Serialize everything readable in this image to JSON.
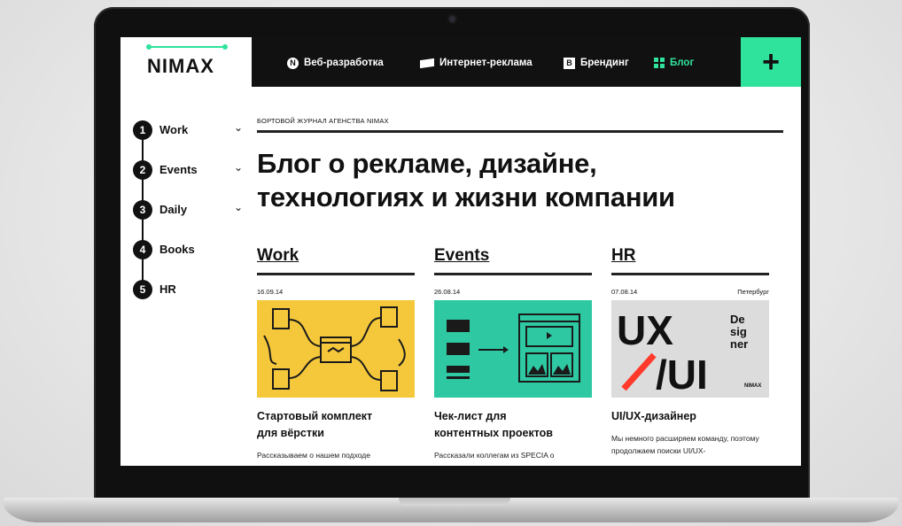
{
  "header": {
    "logo": "NIMAX",
    "nav": [
      {
        "icon": "n-circle-icon",
        "label": "Веб-разработка"
      },
      {
        "icon": "flag-icon",
        "label": "Интернет-реклама"
      },
      {
        "icon": "b-square-icon",
        "label": "Брендинг"
      },
      {
        "icon": "grid-icon",
        "label": "Блог"
      }
    ],
    "plus": "+"
  },
  "sidebar": {
    "items": [
      {
        "num": "1",
        "label": "Work",
        "chevron": "⌄"
      },
      {
        "num": "2",
        "label": "Events",
        "chevron": "⌄"
      },
      {
        "num": "3",
        "label": "Daily",
        "chevron": "⌄"
      },
      {
        "num": "4",
        "label": "Books",
        "chevron": ""
      },
      {
        "num": "5",
        "label": "HR",
        "chevron": ""
      }
    ]
  },
  "main": {
    "kicker": "БОРТОВОЙ ЖУРНАЛ АГЕНСТВА NIMAX",
    "title_line1": "Блог о рекламе, дизайне,",
    "title_line2": "технологиях и жизни компании",
    "columns": [
      {
        "heading": "Work",
        "date": "16.09.14",
        "location": "",
        "card_title_1": "Стартовый комплект",
        "card_title_2": "для вёрстки",
        "text": "Рассказываем о нашем подходе",
        "color": "#f5c83c"
      },
      {
        "heading": "Events",
        "date": "26.08.14",
        "location": "",
        "card_title_1": "Чек-лист для",
        "card_title_2": "контентных проектов",
        "text": "Рассказали коллегам из SPECIA о",
        "color": "#2ec9a3"
      },
      {
        "heading": "HR",
        "date": "07.08.14",
        "location": "Петербург",
        "card_title_1": "UI/UX-дизайнер",
        "card_title_2": "",
        "text": "Мы немного расширяем команду, поэтому продолжаем поиски UI/UX-",
        "color": "#dcdcdc",
        "poster": {
          "ux": "UX",
          "ui": "/UI",
          "de": "De",
          "sig": "sig",
          "ner": "ner",
          "brand": "NIMAX"
        }
      }
    ]
  },
  "colors": {
    "accent": "#2fe39c",
    "dark": "#111111"
  }
}
